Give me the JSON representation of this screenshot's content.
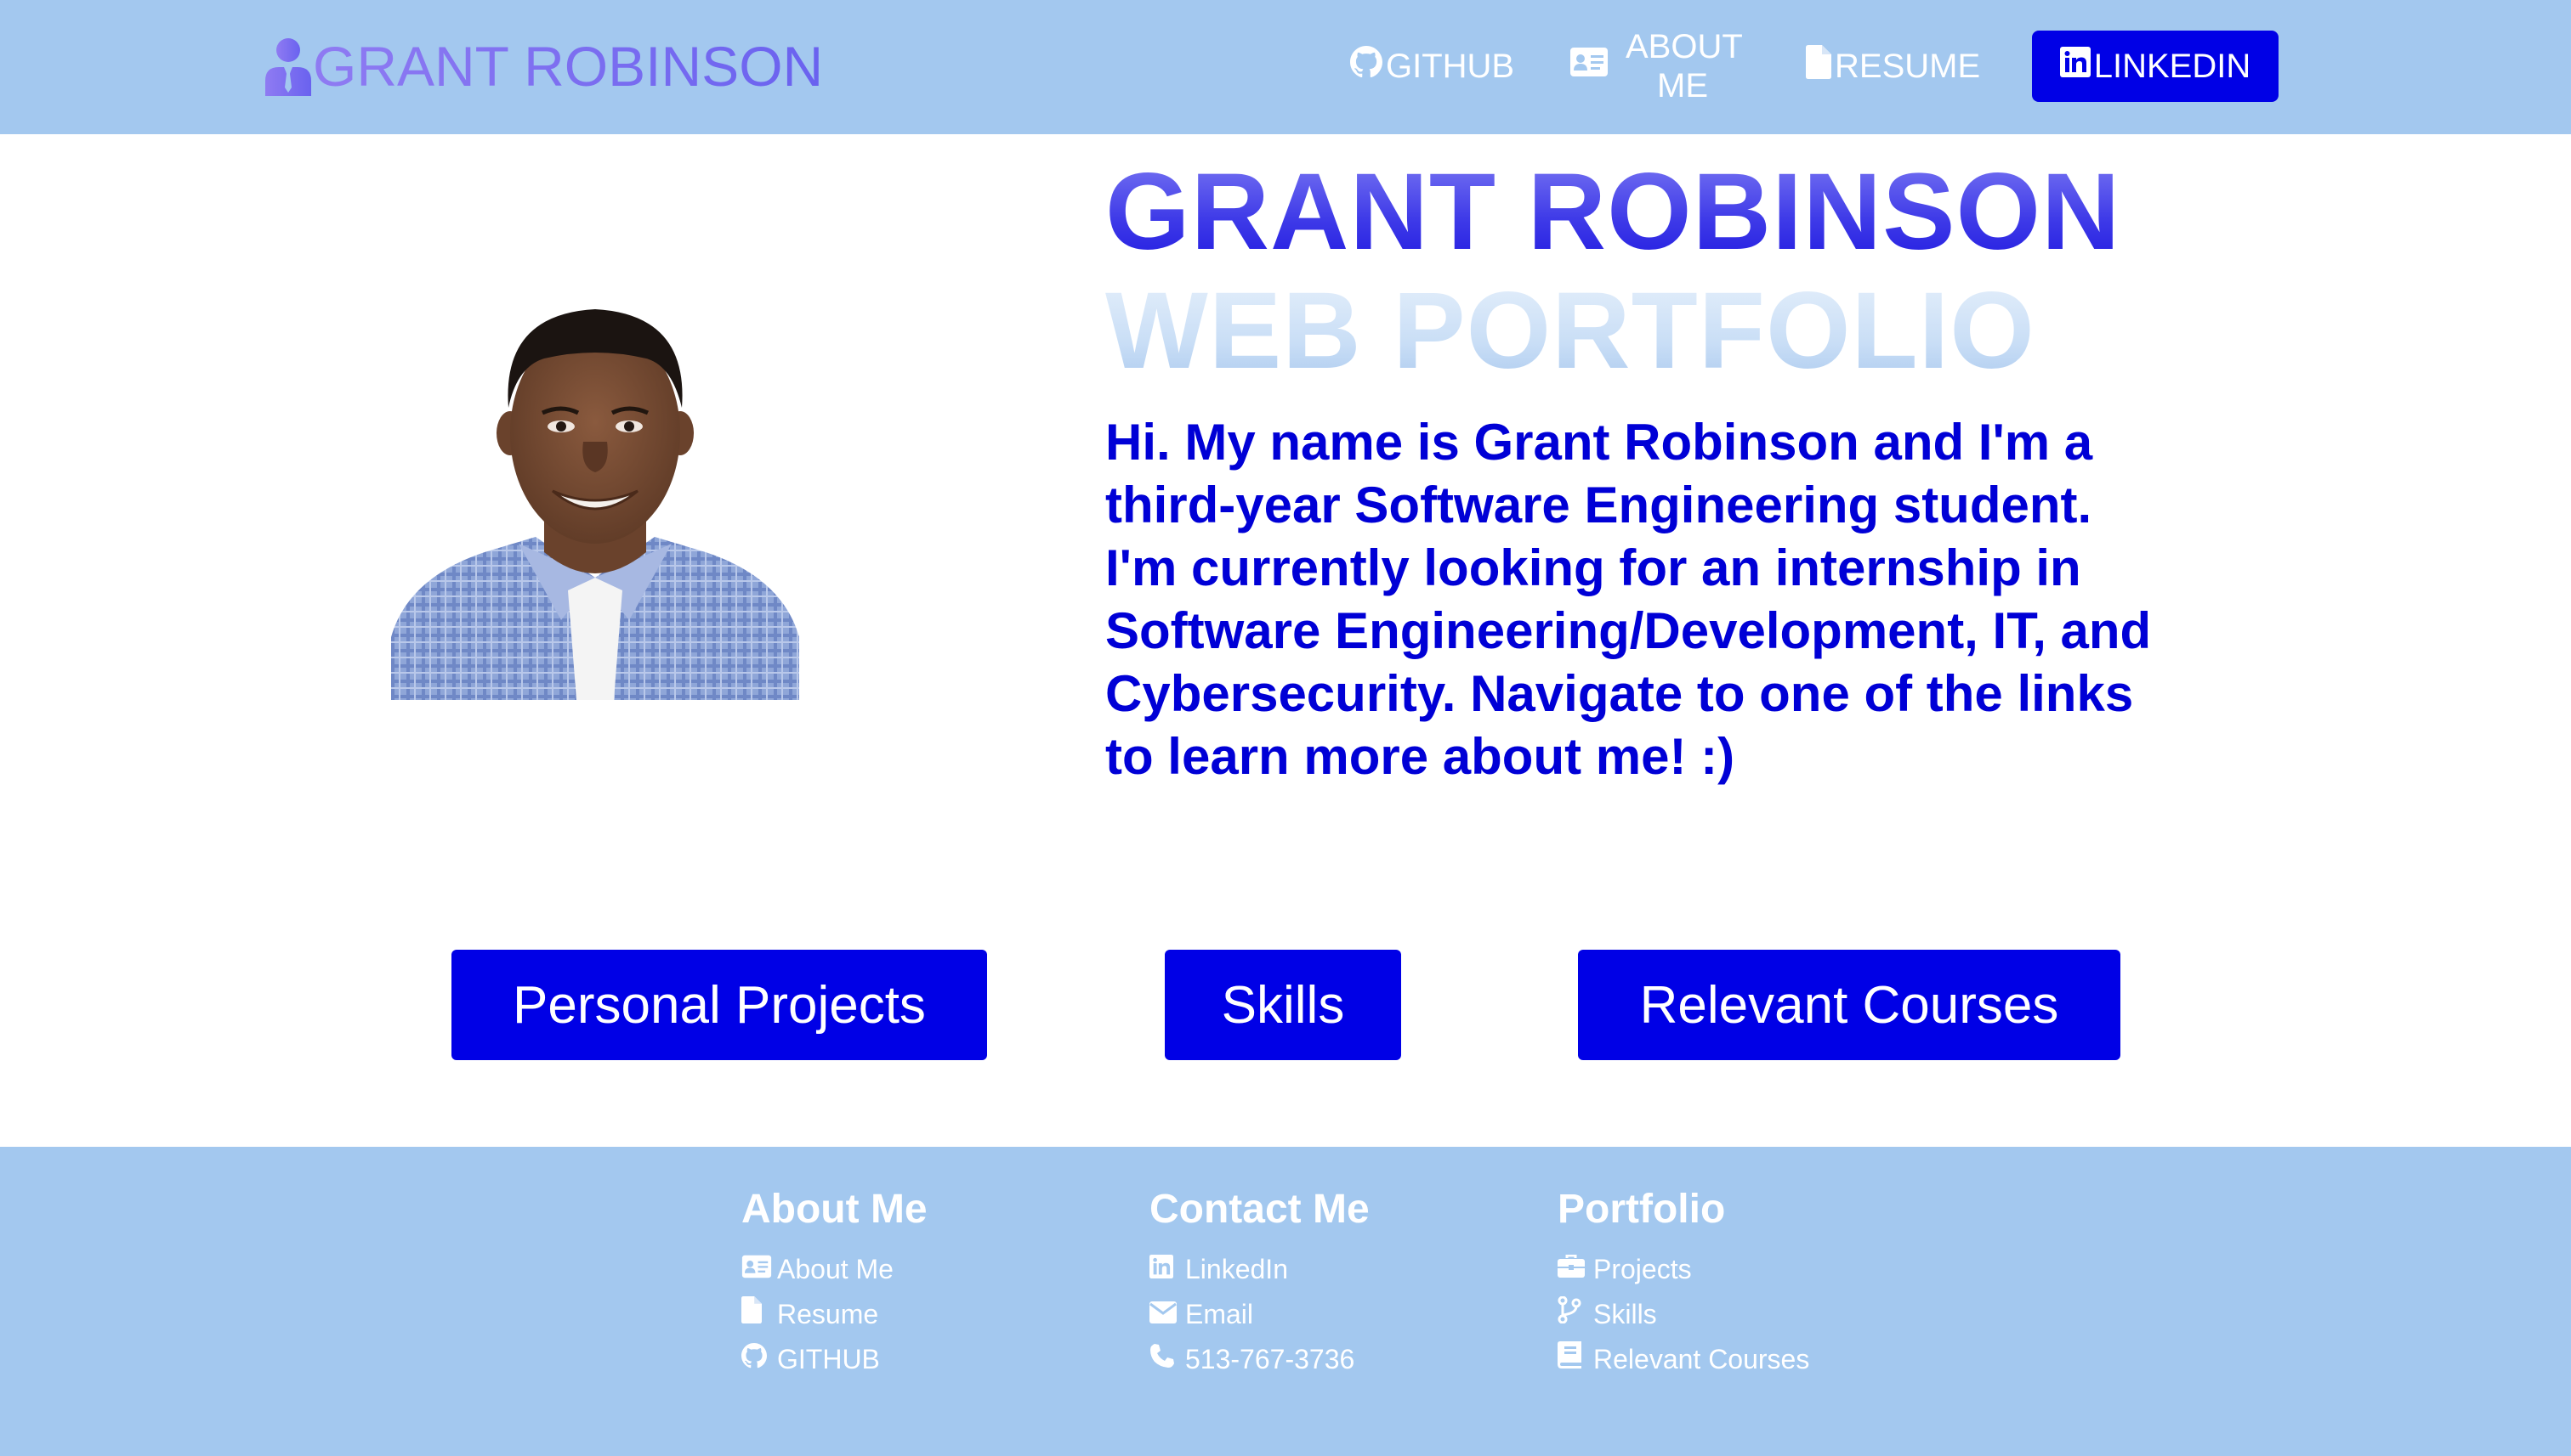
{
  "nav": {
    "brand": "GRANT ROBINSON",
    "github": "GITHUB",
    "about": "ABOUT ME",
    "resume": "RESUME",
    "linkedin": "LINKEDIN"
  },
  "hero": {
    "title_line1": "GRANT ROBINSON",
    "title_line2": "WEB PORTFOLIO",
    "intro": "Hi. My name is Grant Robinson and I'm a third-year Software Engineering student. I'm currently looking for an internship in Software Engineering/Development, IT, and Cybersecurity. Navigate to one of the links to learn more about me! :)"
  },
  "buttons": {
    "projects": "Personal Projects",
    "skills": "Skills",
    "courses": "Relevant Courses"
  },
  "footer": {
    "about": {
      "heading": "About Me",
      "links": [
        "About Me",
        "Resume",
        "GITHUB"
      ]
    },
    "contact": {
      "heading": "Contact Me",
      "links": [
        "LinkedIn",
        "Email",
        "513-767-3736"
      ]
    },
    "portfolio": {
      "heading": "Portfolio",
      "links": [
        "Projects",
        "Skills",
        "Relevant Courses"
      ]
    }
  },
  "colors": {
    "nav_bg": "#a3c8ef",
    "accent": "#0000e6",
    "intro_text": "#0000d6"
  },
  "icons": {
    "brand": "user-tie-icon",
    "github": "github-icon",
    "about": "id-card-icon",
    "resume": "file-icon",
    "linkedin": "linkedin-icon",
    "email": "envelope-icon",
    "phone": "phone-icon",
    "projects": "briefcase-icon",
    "skills": "code-branch-icon",
    "courses": "book-icon"
  }
}
